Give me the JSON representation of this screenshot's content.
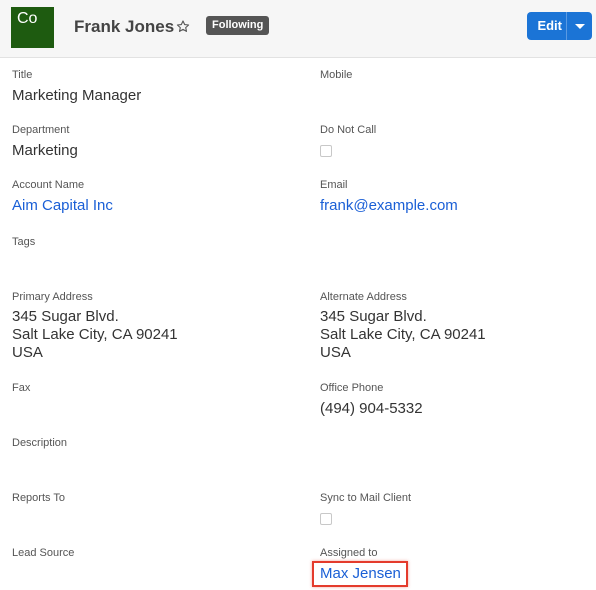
{
  "header": {
    "avatar_text": "Co",
    "avatar_color": "#1e5b10",
    "record_name": "Frank Jones",
    "favorite_icon": "star-outline-icon",
    "following_label": "Following",
    "edit_label": "Edit",
    "edit_menu_icon": "caret-down-icon",
    "accent_color": "#1b74d6"
  },
  "fields": {
    "title": {
      "label": "Title",
      "value": "Marketing Manager"
    },
    "mobile": {
      "label": "Mobile",
      "value": ""
    },
    "department": {
      "label": "Department",
      "value": "Marketing"
    },
    "do_not_call": {
      "label": "Do Not Call",
      "checked": false
    },
    "account_name": {
      "label": "Account Name",
      "value": "Aim Capital Inc"
    },
    "email": {
      "label": "Email",
      "value": "frank@example.com"
    },
    "tags": {
      "label": "Tags",
      "value": ""
    },
    "primary_address": {
      "label": "Primary Address",
      "street": "345 Sugar Blvd.",
      "city_line": "Salt Lake City, CA  90241",
      "country": "USA"
    },
    "alternate_address": {
      "label": "Alternate Address",
      "street": "345 Sugar Blvd.",
      "city_line": "Salt Lake City, CA  90241",
      "country": "USA"
    },
    "fax": {
      "label": "Fax",
      "value": ""
    },
    "office_phone": {
      "label": "Office Phone",
      "value": "(494) 904-5332"
    },
    "description": {
      "label": "Description",
      "value": ""
    },
    "reports_to": {
      "label": "Reports To",
      "value": ""
    },
    "sync_to_mail_client": {
      "label": "Sync to Mail Client",
      "checked": false
    },
    "lead_source": {
      "label": "Lead Source",
      "value": ""
    },
    "assigned_to": {
      "label": "Assigned to",
      "value": "Max Jensen"
    }
  },
  "highlight_color": "#e43b2c"
}
